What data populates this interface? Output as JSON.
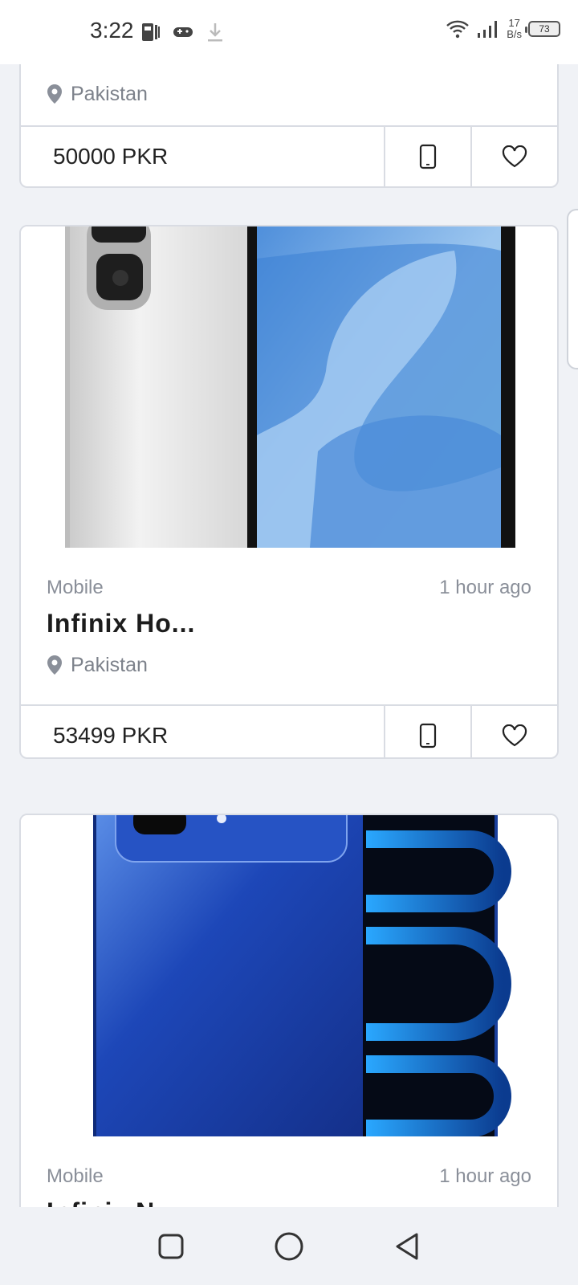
{
  "status": {
    "time": "3:22",
    "net_speed_value": "17",
    "net_speed_unit": "B/s",
    "battery": "73",
    "icons": [
      "sim-icon",
      "gamepad-icon",
      "download-icon",
      "wifi-icon",
      "signal-icon",
      "battery-icon"
    ]
  },
  "cards": [
    {
      "location": "Pakistan",
      "price": "50000 PKR"
    },
    {
      "category": "Mobile",
      "time_ago": "1 hour ago",
      "title": "Infinix Ho...",
      "location": "Pakistan",
      "price": "53499 PKR"
    },
    {
      "category": "Mobile",
      "time_ago": "1 hour ago",
      "title": "Infinix N..."
    }
  ],
  "colors": {
    "background": "#f0f2f6",
    "card_border": "#d9dce3",
    "text_primary": "#1c1c1c",
    "text_muted": "#8a8f99"
  },
  "nav": {
    "icons": [
      "recent-apps-icon",
      "home-icon",
      "back-icon"
    ]
  }
}
